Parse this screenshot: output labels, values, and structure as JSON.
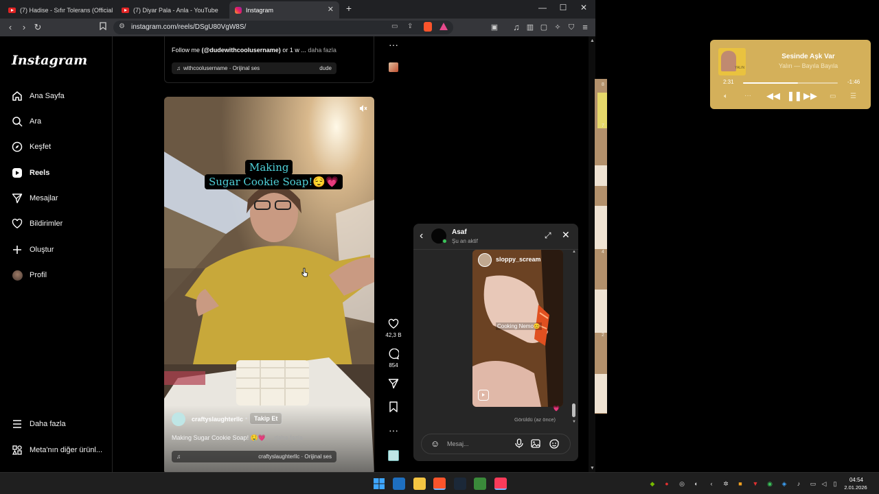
{
  "browser": {
    "tabs": [
      {
        "title": "(7) Hadise - Sıfır Tolerans (Official Vid",
        "icon": "youtube-icon"
      },
      {
        "title": "(7) Diyar Pala - Anla - YouTube",
        "icon": "youtube-icon"
      },
      {
        "title": "Instagram",
        "icon": "instagram-icon"
      }
    ],
    "new_tab": "+",
    "url": "instagram.com/reels/DSgU80VgW8S/"
  },
  "instagram": {
    "logo": "Instagram",
    "nav": [
      {
        "label": "Ana Sayfa",
        "icon": "home-icon"
      },
      {
        "label": "Ara",
        "icon": "search-icon"
      },
      {
        "label": "Keşfet",
        "icon": "compass-icon"
      },
      {
        "label": "Reels",
        "icon": "reels-icon"
      },
      {
        "label": "Mesajlar",
        "icon": "messenger-icon"
      },
      {
        "label": "Bildirimler",
        "icon": "heart-icon"
      },
      {
        "label": "Oluştur",
        "icon": "plus-icon"
      },
      {
        "label": "Profil",
        "icon": "avatar-icon"
      }
    ],
    "nav_bottom": [
      {
        "label": "Daha fazla",
        "icon": "menu-icon"
      },
      {
        "label": "Meta'nın diğer ürünl...",
        "icon": "meta-apps-icon"
      }
    ],
    "prev_post": {
      "caption_prefix": "Follow me ",
      "caption_handle": "(@dudewithcoolusername)",
      "caption_suffix": " or 1 w ...",
      "more": "daha fazla",
      "audio": "withcoolusername · Orijinal ses",
      "audio_right": "dude"
    },
    "reel": {
      "title_line1": "Making",
      "title_line2": "Sugar Cookie Soap!😌💗",
      "username": "craftyslaughterllc",
      "follow": "Takip Et",
      "caption": "Making Sugar Cookie Soap! 🤤💗",
      "more": "... daha fazla",
      "audio": "craftyslaughterllc · Orijinal ses",
      "likes": "42,3 B",
      "comments": "854"
    }
  },
  "dm": {
    "name": "Asaf",
    "status": "Şu an aktif",
    "shared_user": "sloppy_scream",
    "shared_caption": "Cooking Nemo😊",
    "seen": "Görüldü (az önce)",
    "reaction": "💗",
    "placeholder": "Mesaj..."
  },
  "music": {
    "title": "Sesinde Aşk Var",
    "artist": "Yalın — Bayıla Bayıla",
    "elapsed": "2:31",
    "remaining": "-1:46",
    "progress": 0.58,
    "album_text": "YALIN"
  },
  "background_app": {
    "numbers": [
      "8",
      "7",
      "6",
      "5",
      "4",
      "3",
      "2",
      "1"
    ]
  },
  "taskbar": {
    "time": "04:54",
    "date": "2.01.2026"
  },
  "colors": {
    "accent": "#4fd1d9",
    "music_bg": "#d4b05a",
    "ig_bg": "#000000",
    "dm_bg": "#262626"
  }
}
